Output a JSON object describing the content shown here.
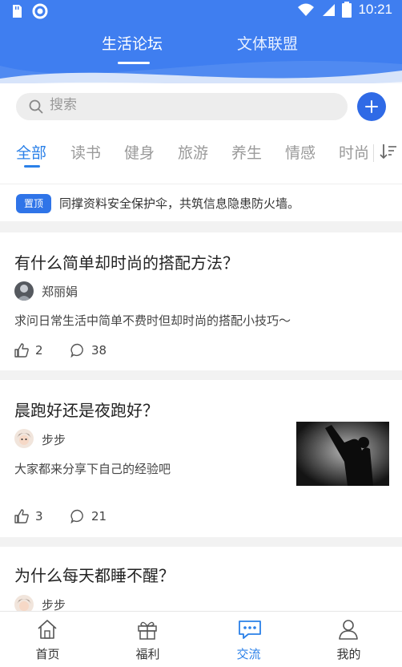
{
  "status_bar": {
    "time": "10:21"
  },
  "top_tabs": [
    {
      "label": "生活论坛",
      "active": true
    },
    {
      "label": "文体联盟",
      "active": false
    }
  ],
  "search": {
    "placeholder": "搜索"
  },
  "categories": [
    {
      "label": "全部",
      "active": true
    },
    {
      "label": "读书"
    },
    {
      "label": "健身"
    },
    {
      "label": "旅游"
    },
    {
      "label": "养生"
    },
    {
      "label": "情感"
    },
    {
      "label": "时尚"
    }
  ],
  "pinned": {
    "badge": "置顶",
    "text": "同撑资料安全保护伞，共筑信息隐患防火墙。"
  },
  "posts": [
    {
      "title": "有什么简单却时尚的搭配方法？",
      "author": "郑丽娟",
      "excerpt": "求问日常生活中简单不费时但却时尚的搭配小技巧～",
      "likes": "2",
      "comments": "38"
    },
    {
      "title": "晨跑好还是夜跑好？",
      "author": "步步",
      "excerpt": "大家都来分享下自己的经验吧",
      "likes": "3",
      "comments": "21"
    },
    {
      "title": "为什么每天都睡不醒？",
      "author": "步步"
    }
  ],
  "bottom_nav": [
    {
      "label": "首页",
      "icon": "home-icon"
    },
    {
      "label": "福利",
      "icon": "gift-icon"
    },
    {
      "label": "交流",
      "icon": "chat-icon",
      "active": true
    },
    {
      "label": "我的",
      "icon": "user-icon"
    }
  ],
  "colors": {
    "header": "#3f7ef0",
    "accent": "#2a80e8",
    "pin_badge": "#2f74e8"
  }
}
